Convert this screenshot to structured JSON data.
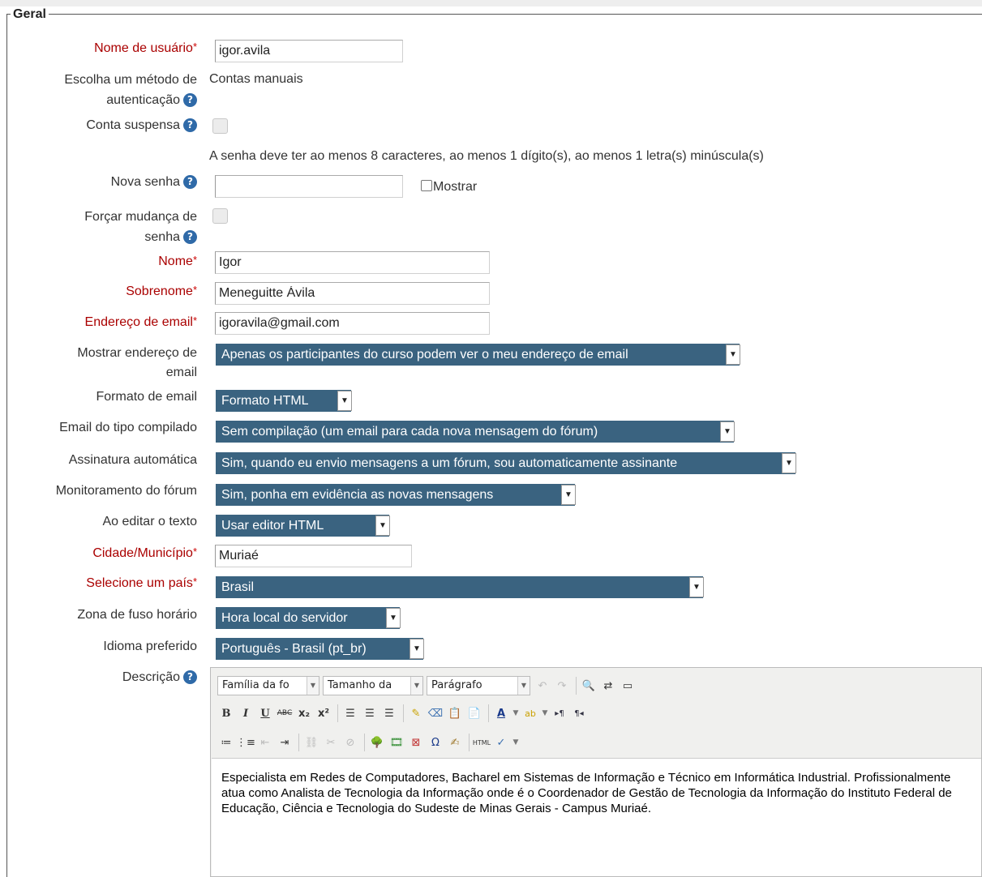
{
  "fieldset": {
    "legend": "Geral"
  },
  "fields": {
    "username": {
      "label": "Nome de usuário",
      "value": "igor.avila"
    },
    "auth": {
      "label_line1": "Escolha um método de",
      "label_line2": "autenticação",
      "value": "Contas manuais"
    },
    "suspended": {
      "label": "Conta suspensa"
    },
    "password_rule": "A senha deve ter ao menos 8 caracteres, ao menos 1 dígito(s), ao menos 1 letra(s) minúscula(s)",
    "new_password": {
      "label": "Nova senha",
      "value": "",
      "show_label": "Mostrar"
    },
    "force_change": {
      "label_line1": "Forçar mudança de",
      "label_line2": "senha"
    },
    "firstname": {
      "label": "Nome",
      "value": "Igor"
    },
    "lastname": {
      "label": "Sobrenome",
      "value": "Meneguitte Ávila"
    },
    "email": {
      "label": "Endereço de email",
      "value": "igoravila@gmail.com"
    },
    "maildisplay": {
      "label_line1": "Mostrar endereço de",
      "label_line2": "email",
      "value": "Apenas os participantes do curso podem ver o meu endereço de email"
    },
    "mailformat": {
      "label": "Formato de email",
      "value": "Formato HTML"
    },
    "maildigest": {
      "label": "Email do tipo compilado",
      "value": "Sem compilação (um email para cada nova mensagem do fórum)"
    },
    "autosubscribe": {
      "label": "Assinatura automática",
      "value": "Sim, quando eu envio mensagens a um fórum, sou automaticamente assinante"
    },
    "trackforums": {
      "label": "Monitoramento do fórum",
      "value": "Sim, ponha em evidência as novas mensagens"
    },
    "htmleditor": {
      "label": "Ao editar o texto",
      "value": "Usar editor HTML"
    },
    "city": {
      "label": "Cidade/Município",
      "value": "Muriaé"
    },
    "country": {
      "label": "Selecione um país",
      "value": "Brasil"
    },
    "timezone": {
      "label": "Zona de fuso horário",
      "value": "Hora local do servidor"
    },
    "lang": {
      "label": "Idioma preferido",
      "value": "Português - Brasil (pt_br)"
    },
    "description": {
      "label": "Descrição",
      "font_family": "Família da fo",
      "font_size": "Tamanho da",
      "format": "Parágrafo",
      "text": "Especialista em Redes de Computadores, Bacharel em Sistemas de Informação e Técnico em Informática Industrial. Profissionalmente atua como Analista de Tecnologia da Informação onde é o Coordenador de Gestão de Tecnologia da Informação do Instituto Federal de Educação, Ciência e Tecnologia do Sudeste de Minas Gerais - Campus Muriaé."
    }
  },
  "colors": {
    "required_label": "#aa0000",
    "select_bg": "#3a6380",
    "help_icon": "#2f6aa8"
  }
}
